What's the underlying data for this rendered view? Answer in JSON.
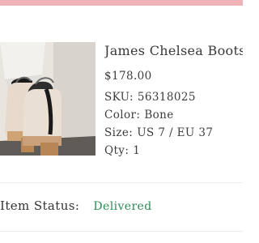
{
  "theme": {
    "top_bar_color": "#efb2b5",
    "status_color": "#2e8a57"
  },
  "product": {
    "image_icon": "boot-product-image",
    "title": "James Chelsea Boots",
    "price": "$178.00",
    "sku_label": "SKU:",
    "sku_value": "56318025",
    "color_label": "Color:",
    "color_value": "Bone",
    "size_label": "Size:",
    "size_value": "US 7 / EU 37",
    "qty_label": "Qty:",
    "qty_value": "1"
  },
  "status": {
    "label": "Item Status:",
    "value": "Delivered"
  }
}
